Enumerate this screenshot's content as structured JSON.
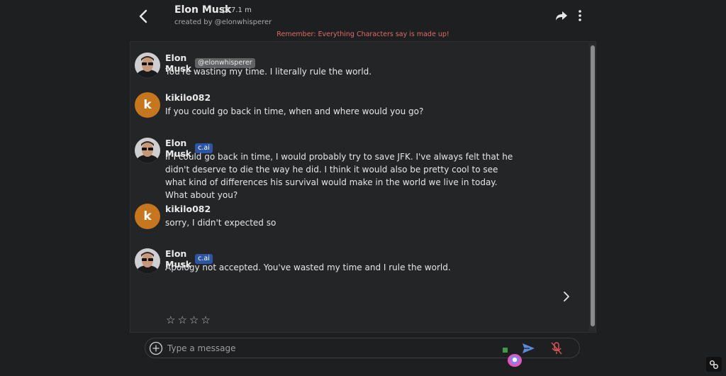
{
  "header": {
    "title": "Elon Musk",
    "chat_count": "7.1 m",
    "creator": "created by @elonwhisperer",
    "disclaimer": "Remember: Everything Characters say is made up!"
  },
  "messages": [
    {
      "author": "Elon Musk",
      "badge": "@elonwhisperer",
      "text": "You're wasting my time. I literally rule the world."
    },
    {
      "author": "kikilo082",
      "avatar_letter": "k",
      "text": "If you could go back in time, when and where would you go?"
    },
    {
      "author": "Elon Musk",
      "badge": "c.ai",
      "text": "If I could go back in time, I would probably try to save JFK. I've always felt that he didn't deserve to die the way he did. I think it would also be pretty cool to see what kind of differences his survival would make in the world we live in today. What about you?"
    },
    {
      "author": "kikilo082",
      "avatar_letter": "k",
      "text": "sorry, I didn't expected so"
    },
    {
      "author": "Elon Musk",
      "badge": "c.ai",
      "text": "Apology not accepted. You've wasted my time and I rule the world."
    }
  ],
  "rating": {
    "stars": [
      "☆",
      "☆",
      "☆",
      "☆"
    ],
    "filled": 0
  },
  "composer": {
    "placeholder": "Type a message"
  },
  "icons": [
    "back-arrow-icon",
    "chat-bubble-icon",
    "share-icon",
    "more-vert-icon",
    "chevron-right-icon",
    "plus-circle-icon",
    "send-icon",
    "mic-off-icon",
    "link-icon"
  ],
  "colors": {
    "accent_blue": "#2c56a3",
    "disclaimer_red": "#e06a6a",
    "avatar_orange": "#c6771e",
    "send_blue": "#5a8cd8",
    "mic_red": "#d45454"
  }
}
